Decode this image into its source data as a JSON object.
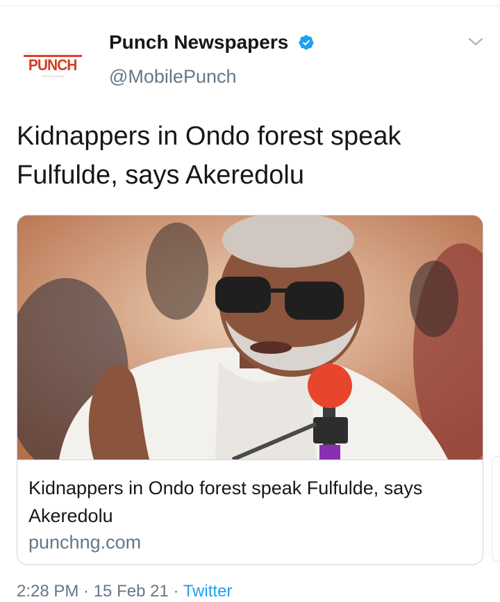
{
  "author": {
    "name": "Punch Newspapers",
    "handle": "@MobilePunch",
    "avatar_logo_text": "PUNCH",
    "verified_icon": "verified-badge-icon"
  },
  "tweet": {
    "text": "Kidnappers in Ondo forest speak Fulfulde, says Akeredolu"
  },
  "card": {
    "title": "Kidnappers in Ondo forest speak Fulfulde, says Akeredolu",
    "domain": "punchng.com"
  },
  "meta": {
    "time_partial": "2:28 PM · 15 Feb 21 · ",
    "source_partial": "Twitter"
  },
  "colors": {
    "accent": "#1da1f2",
    "text": "#14171a",
    "secondary": "#657786",
    "border": "#ccd6dd",
    "brand": "#d63b1f"
  }
}
